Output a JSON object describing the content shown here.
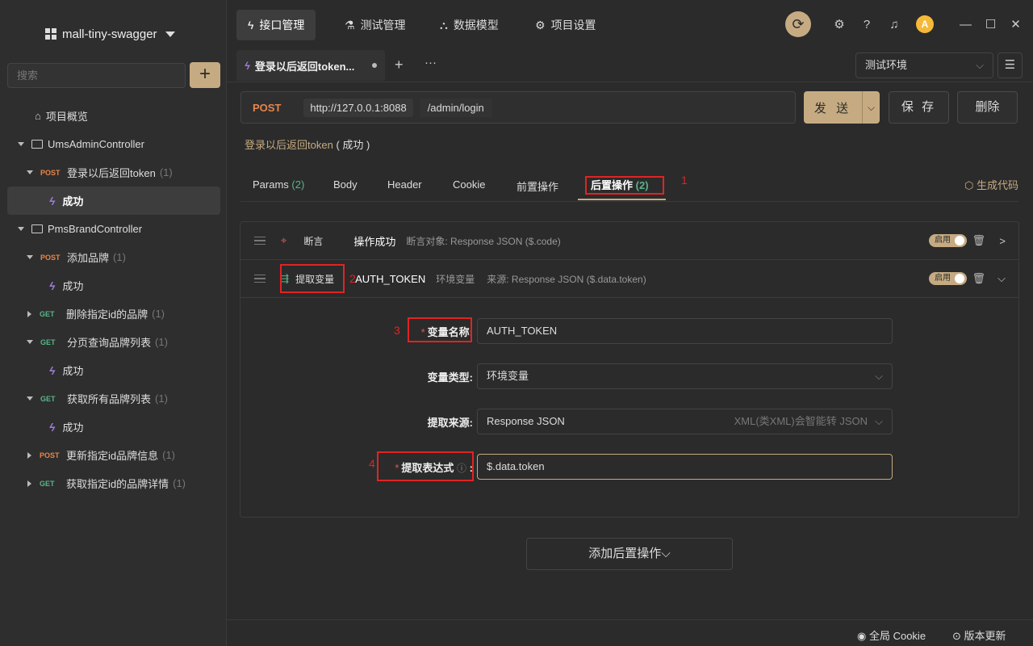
{
  "project": {
    "name": "mall-tiny-swagger"
  },
  "sidebar": {
    "search_placeholder": "搜索",
    "add_label": "+",
    "overview": "项目概览",
    "tree": {
      "c1": {
        "label": "UmsAdminController"
      },
      "n1": {
        "method": "POST",
        "label": "登录以后返回token",
        "count": "(1)"
      },
      "n1c": {
        "label": "成功"
      },
      "c2": {
        "label": "PmsBrandController"
      },
      "n2": {
        "method": "POST",
        "label": "添加品牌",
        "count": "(1)"
      },
      "n2c": {
        "label": "成功"
      },
      "n3": {
        "method": "GET",
        "label": "删除指定id的品牌",
        "count": "(1)"
      },
      "n4": {
        "method": "GET",
        "label": "分页查询品牌列表",
        "count": "(1)"
      },
      "n4c": {
        "label": "成功"
      },
      "n5": {
        "method": "GET",
        "label": "获取所有品牌列表",
        "count": "(1)"
      },
      "n5c": {
        "label": "成功"
      },
      "n6": {
        "method": "POST",
        "label": "更新指定id品牌信息",
        "count": "(1)"
      },
      "n7": {
        "method": "GET",
        "label": "获取指定id的品牌详情",
        "count": "(1)"
      }
    }
  },
  "topbar": {
    "tabs": {
      "api": "接口管理",
      "test": "测试管理",
      "model": "数据模型",
      "settings": "项目设置"
    }
  },
  "request_tab": {
    "title": "登录以后返回token..."
  },
  "environment": {
    "selected": "测试环境"
  },
  "request": {
    "method": "POST",
    "host": "http://127.0.0.1:8088",
    "path": "/admin/login",
    "send": "发 送",
    "save": "保 存",
    "delete": "删除",
    "breadcrumb": "登录以后返回token",
    "status": "( 成功 )"
  },
  "param_tabs": {
    "params": "Params",
    "params_count": "(2)",
    "body": "Body",
    "header": "Header",
    "cookie": "Cookie",
    "pre": "前置操作",
    "post": "后置操作",
    "post_count": "(2)",
    "gen_code": "生成代码"
  },
  "annotations": {
    "a1": "1",
    "a2": "2",
    "a3": "3",
    "a4": "4"
  },
  "post_ops": {
    "assert": {
      "type": "断言",
      "name": "操作成功",
      "desc": "断言对象: Response JSON ($.code)",
      "toggle": "启用"
    },
    "extract": {
      "type": "提取变量",
      "name": "AUTH_TOKEN",
      "scope": "环境变量",
      "desc": "来源: Response JSON ($.data.token)",
      "toggle": "启用"
    }
  },
  "form": {
    "var_name_label": "变量名称:",
    "var_name": "AUTH_TOKEN",
    "var_type_label": "变量类型:",
    "var_type": "环境变量",
    "source_label": "提取来源:",
    "source": "Response JSON",
    "source_hint": "XML(类XML)会智能转 JSON",
    "expr_label": "提取表达式",
    "expr_colon": ":",
    "expr": "$.data.token",
    "required_mark": "*"
  },
  "add_post": "添加后置操作",
  "statusbar": {
    "cookie": "全局 Cookie",
    "update": "版本更新"
  },
  "colors": {
    "accent": "#c6ab82",
    "post": "#e8854a",
    "get": "#59b58a",
    "annotation": "#e02424"
  }
}
